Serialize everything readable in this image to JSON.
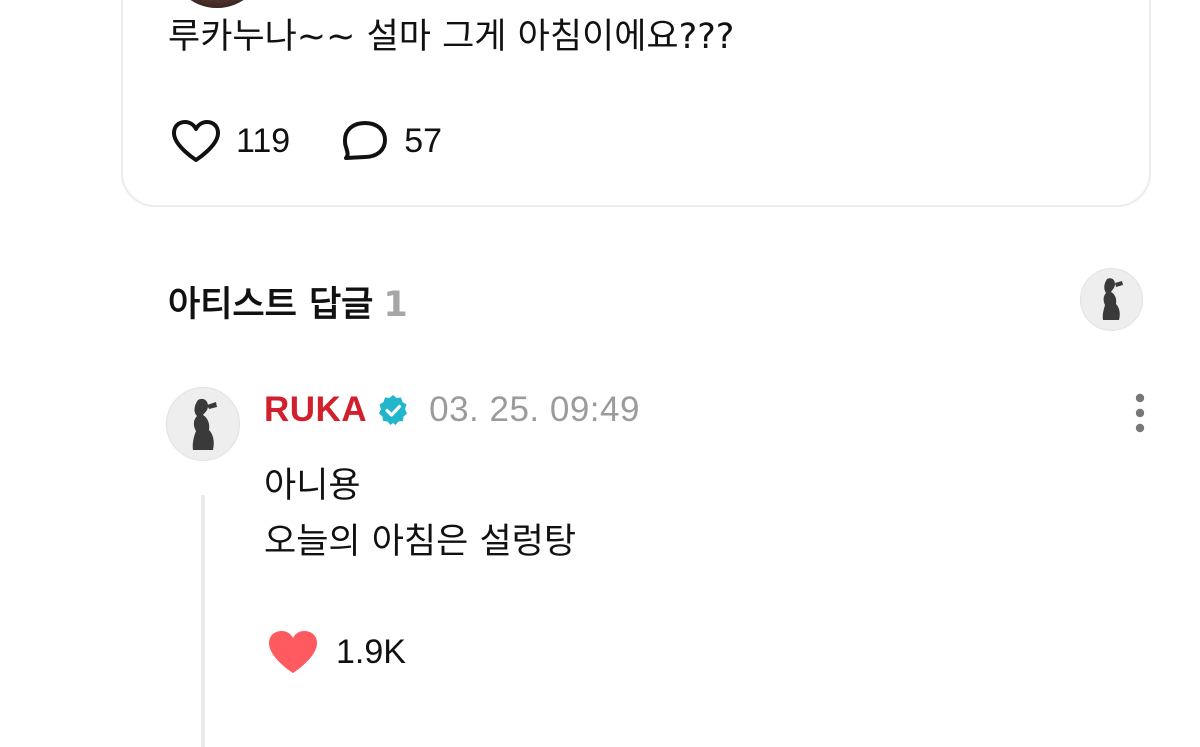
{
  "post": {
    "text": "루카누나~~ 설마 그게 아침이에요???",
    "likes": "119",
    "comments": "57"
  },
  "section": {
    "title": "아티스트 답글",
    "count": "1"
  },
  "reply": {
    "author": "RUKA",
    "timestamp": "03. 25. 09:49",
    "lines": [
      "아니용",
      "오늘의 아침은 설렁탕"
    ],
    "likes": "1.9K"
  },
  "colors": {
    "author": "#d21f2b",
    "verified": "#22b6cc",
    "liked_heart": "#ff5a5f",
    "muted": "#9b9b9b"
  },
  "icons": {
    "like": "heart-outline-icon",
    "comment": "speech-bubble-icon",
    "verified": "verified-badge-icon",
    "more": "more-vertical-icon",
    "liked": "heart-filled-icon"
  }
}
